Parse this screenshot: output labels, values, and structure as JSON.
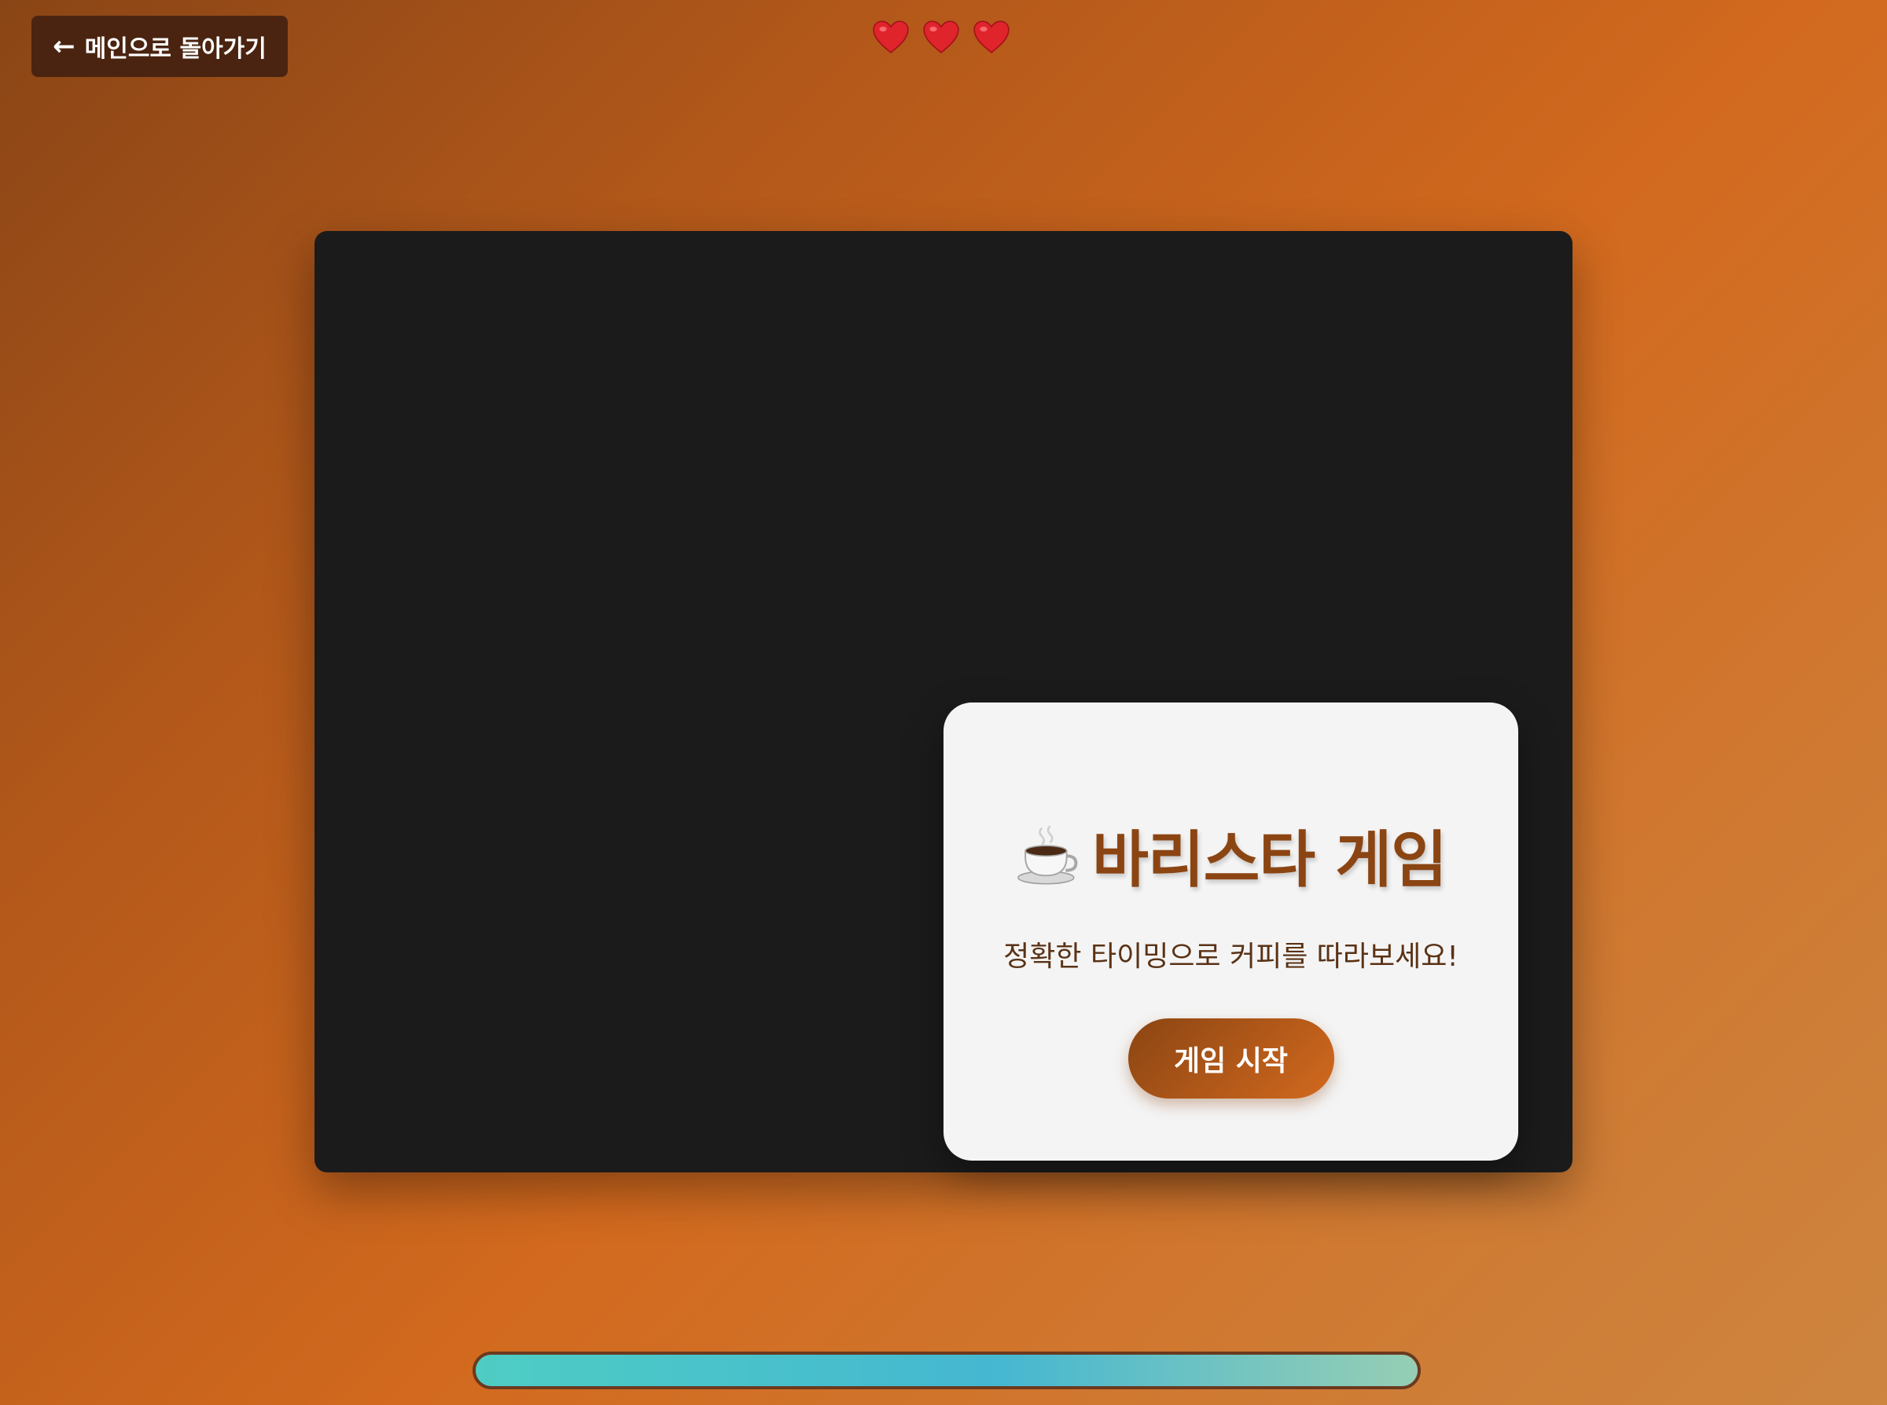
{
  "nav": {
    "back_label": "메인으로 돌아가기",
    "back_icon": "arrow-left-icon"
  },
  "lives": {
    "count": 3,
    "icon": "heart-icon",
    "color": "#e0242c"
  },
  "start_screen": {
    "title_icon": "coffee-cup-icon",
    "title": "바리스타 게임",
    "subtitle": "정확한 타이밍으로 커피를 따라보세요!",
    "start_button_label": "게임 시작"
  },
  "progress": {
    "fill_fraction": 1.0,
    "colors": [
      "#4ecdc4",
      "#45b7d1",
      "#96ceb4"
    ]
  },
  "colors": {
    "background_start": "#8b4513",
    "background_end": "#cd853f",
    "game_screen": "#1b1b1b",
    "title": "#8b4513",
    "subtitle": "#5a3215",
    "button_start": "#8b4513",
    "button_end": "#d2691e"
  }
}
